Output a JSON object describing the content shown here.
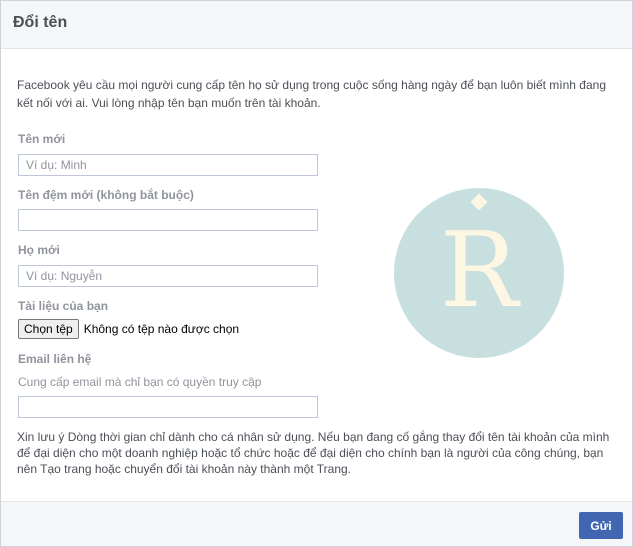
{
  "dialog": {
    "title": "Đổi tên",
    "intro": "Facebook yêu cầu mọi người cung cấp tên họ sử dụng trong cuộc sống hàng ngày để bạn luôn biết mình đang kết nối với ai. Vui lòng nhập tên bạn muốn trên tài khoản."
  },
  "form": {
    "first_name": {
      "label": "Tên mới",
      "value": "",
      "placeholder": "Ví dụ: Minh"
    },
    "middle_name": {
      "label": "Tên đệm mới (không bắt buộc)",
      "value": "",
      "placeholder": ""
    },
    "last_name": {
      "label": "Họ mới",
      "value": "",
      "placeholder": "Ví dụ: Nguyễn"
    },
    "document": {
      "label": "Tài liệu của bạn",
      "button_label": "Chọn tệp",
      "status": "Không có tệp nào được chọn"
    },
    "email": {
      "label": "Email liên hệ",
      "hint": "Cung cấp email mà chỉ bạn có quyền truy cập",
      "value": "",
      "placeholder": ""
    }
  },
  "note": "Xin lưu ý Dòng thời gian chỉ dành cho cá nhân sử dụng. Nếu bạn đang cố gắng thay đổi tên tài khoản của mình để đại diện cho một doanh nghiệp hoặc tổ chức hoặc để đại diện cho chính bạn là người của công chúng, bạn nên Tạo trang hoặc chuyển đổi tài khoản này thành một Trang.",
  "footer": {
    "submit_label": "Gửi"
  },
  "watermark": {
    "letter": "R",
    "circle_color": "#c8dfe0",
    "letter_color": "#fdf6e3"
  }
}
